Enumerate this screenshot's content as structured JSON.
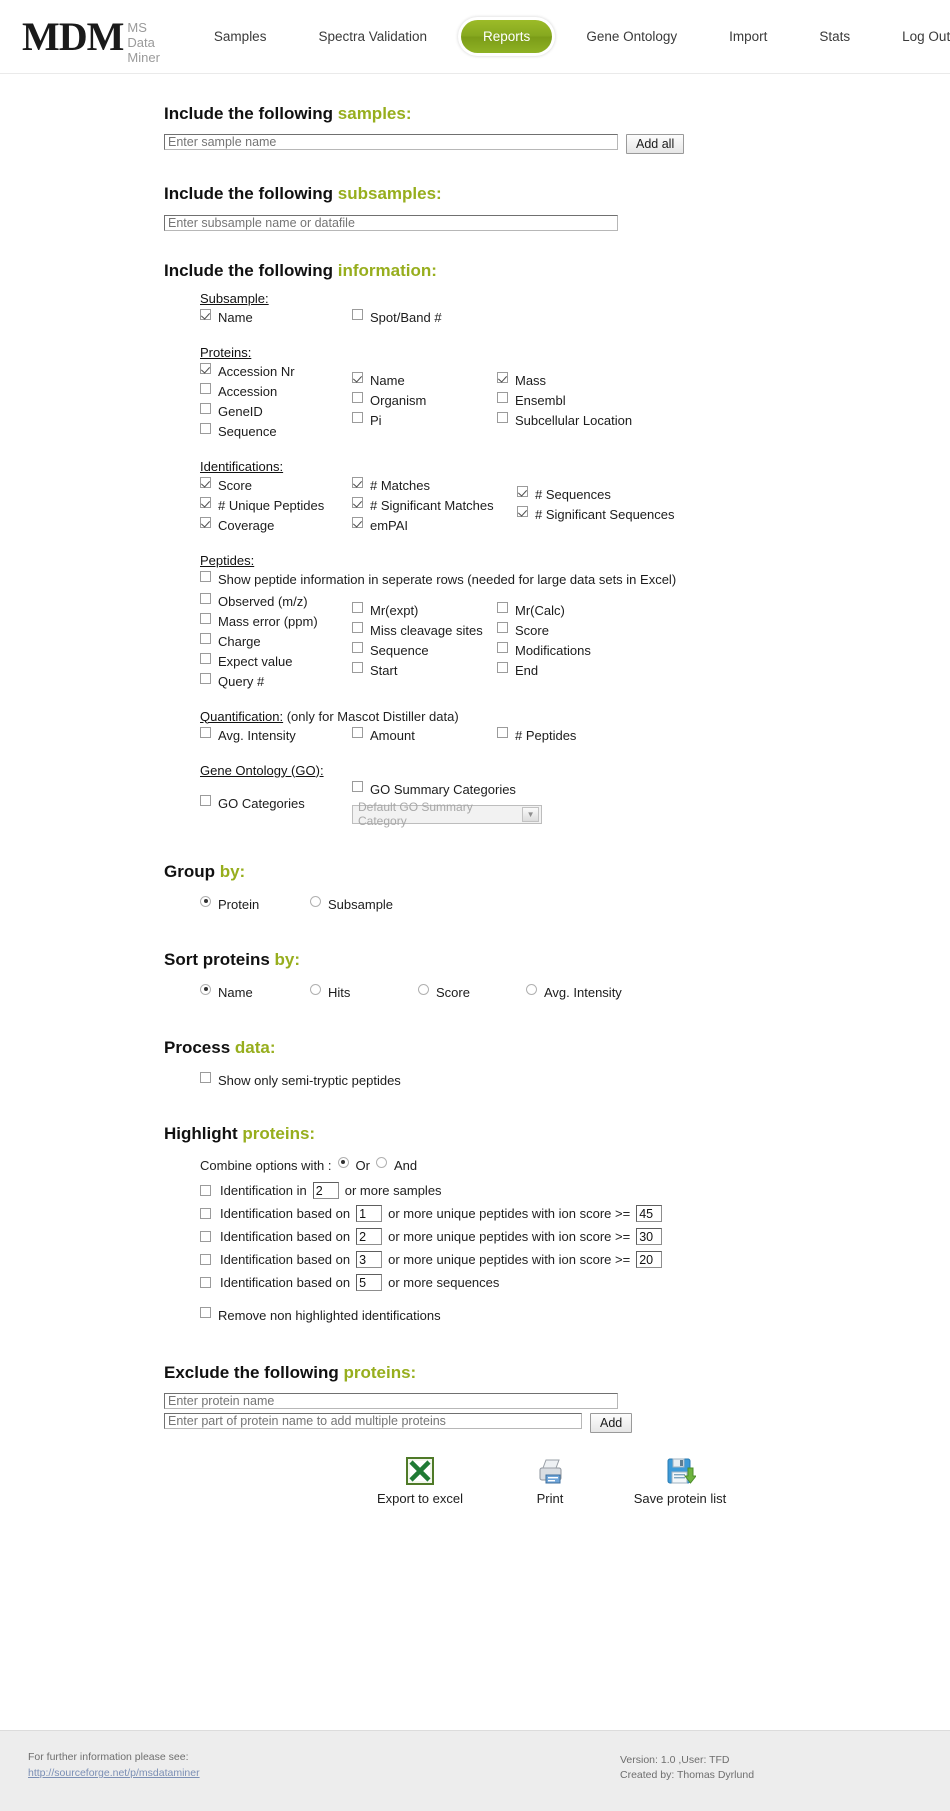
{
  "header": {
    "logo": "MDM",
    "logo_subtitle": "MS Data Miner",
    "nav": [
      {
        "label": "Samples",
        "active": false
      },
      {
        "label": "Spectra Validation",
        "active": false
      },
      {
        "label": "Reports",
        "active": true
      },
      {
        "label": "Gene Ontology",
        "active": false
      },
      {
        "label": "Import",
        "active": false
      },
      {
        "label": "Stats",
        "active": false
      },
      {
        "label": "Log Out",
        "active": false
      }
    ],
    "accent_color": "#8fb224"
  },
  "samples_section": {
    "title_prefix": "Include the following ",
    "title_accent": "samples:",
    "input_placeholder": "Enter sample name",
    "add_all_label": "Add all"
  },
  "subsamples_section": {
    "title_prefix": "Include the following ",
    "title_accent": "subsamples:",
    "input_placeholder": "Enter subsample name or datafile"
  },
  "information_section": {
    "title_prefix": "Include the following ",
    "title_accent": "information:",
    "groups": [
      {
        "heading": "Subsample:",
        "columns": [
          [
            {
              "label": "Name",
              "checked": true
            }
          ],
          [
            {
              "label": "Spot/Band #",
              "checked": false
            }
          ],
          []
        ]
      },
      {
        "heading": "Proteins:",
        "columns": [
          [
            {
              "label": "Accession Nr",
              "checked": true
            },
            {
              "label": "Accession",
              "checked": false
            },
            {
              "label": "GeneID",
              "checked": false
            },
            {
              "label": "Sequence",
              "checked": false
            }
          ],
          [
            {
              "label": "Name",
              "checked": true
            },
            {
              "label": "Organism",
              "checked": false
            },
            {
              "label": "Pi",
              "checked": false
            }
          ],
          [
            {
              "label": "Mass",
              "checked": true
            },
            {
              "label": "Ensembl",
              "checked": false
            },
            {
              "label": "Subcellular Location",
              "checked": false
            }
          ]
        ]
      },
      {
        "heading": "Identifications:",
        "columns": [
          [
            {
              "label": "Score",
              "checked": true
            },
            {
              "label": "# Unique Peptides",
              "checked": true
            },
            {
              "label": "Coverage",
              "checked": true
            }
          ],
          [
            {
              "label": "# Matches",
              "checked": true
            },
            {
              "label": "# Significant Matches",
              "checked": true
            },
            {
              "label": "emPAI",
              "checked": true
            }
          ],
          [
            {
              "label": "# Sequences",
              "checked": true
            },
            {
              "label": "# Significant Sequences",
              "checked": true
            }
          ]
        ]
      }
    ],
    "peptides": {
      "heading": "Peptides:",
      "full_width_option": {
        "label": "Show peptide information in seperate rows (needed for large data sets in Excel)",
        "checked": false
      },
      "columns": [
        [
          {
            "label": "Observed (m/z)",
            "checked": false
          },
          {
            "label": "Mass error (ppm)",
            "checked": false
          },
          {
            "label": "Charge",
            "checked": false
          },
          {
            "label": "Expect value",
            "checked": false
          },
          {
            "label": "Query #",
            "checked": false
          }
        ],
        [
          {
            "label": "Mr(expt)",
            "checked": false
          },
          {
            "label": "Miss cleavage sites",
            "checked": false
          },
          {
            "label": "Sequence",
            "checked": false
          },
          {
            "label": "Start",
            "checked": false
          }
        ],
        [
          {
            "label": "Mr(Calc)",
            "checked": false
          },
          {
            "label": "Score",
            "checked": false
          },
          {
            "label": "Modifications",
            "checked": false
          },
          {
            "label": "End",
            "checked": false
          }
        ]
      ]
    },
    "quantification": {
      "heading": "Quantification:",
      "heading_note": " (only for Mascot Distiller data)",
      "columns": [
        [
          {
            "label": "Avg. Intensity",
            "checked": false
          }
        ],
        [
          {
            "label": "Amount",
            "checked": false
          }
        ],
        [
          {
            "label": "# Peptides",
            "checked": false
          }
        ]
      ]
    },
    "gene_ontology": {
      "heading": "Gene Ontology (GO):",
      "go_categories": {
        "label": "GO Categories",
        "checked": false
      },
      "go_summary_categories": {
        "label": "GO Summary Categories",
        "checked": false
      },
      "select_value": "Default GO Summary Category"
    }
  },
  "group_by": {
    "title_prefix": "Group ",
    "title_accent": "by:",
    "options": [
      {
        "label": "Protein",
        "selected": true
      },
      {
        "label": "Subsample",
        "selected": false
      }
    ]
  },
  "sort_by": {
    "title_prefix": "Sort proteins ",
    "title_accent": "by:",
    "options": [
      {
        "label": "Name",
        "selected": true
      },
      {
        "label": "Hits",
        "selected": false
      },
      {
        "label": "Score",
        "selected": false
      },
      {
        "label": "Avg. Intensity",
        "selected": false
      }
    ]
  },
  "process_data": {
    "title_prefix": "Process ",
    "title_accent": "data:",
    "options": [
      {
        "label": "Show only semi-tryptic peptides",
        "checked": false
      }
    ]
  },
  "highlight_proteins": {
    "title_prefix": "Highlight ",
    "title_accent": "proteins:",
    "combine_label": "Combine options with :",
    "combine_options": [
      {
        "label": "Or",
        "selected": true
      },
      {
        "label": "And",
        "selected": false
      }
    ],
    "rules": [
      {
        "checked": false,
        "text_before": "Identification in",
        "value1": "2",
        "text_middle": "or more samples",
        "value2": null,
        "text_after": null
      },
      {
        "checked": false,
        "text_before": "Identification based on",
        "value1": "1",
        "text_middle": "or more unique peptides with ion score >=",
        "value2": "45",
        "text_after": ""
      },
      {
        "checked": false,
        "text_before": "Identification based on",
        "value1": "2",
        "text_middle": "or more unique peptides with ion score >=",
        "value2": "30",
        "text_after": ""
      },
      {
        "checked": false,
        "text_before": "Identification based on",
        "value1": "3",
        "text_middle": "or more unique peptides with ion score >=",
        "value2": "20",
        "text_after": ""
      },
      {
        "checked": false,
        "text_before": "Identification based on",
        "value1": "5",
        "text_middle": "or more sequences",
        "value2": null,
        "text_after": null
      }
    ],
    "remove_option": {
      "label": "Remove non highlighted identifications",
      "checked": false
    }
  },
  "exclude_proteins": {
    "title_prefix": "Exclude the following ",
    "title_accent": "proteins:",
    "input1_placeholder": "Enter protein name",
    "input2_placeholder": "Enter part of protein name to add multiple proteins",
    "add_label": "Add"
  },
  "actions": [
    {
      "label": "Export to excel",
      "icon": "excel-icon"
    },
    {
      "label": "Print",
      "icon": "printer-icon"
    },
    {
      "label": "Save protein list",
      "icon": "floppy-save-icon"
    }
  ],
  "footer": {
    "info_text": "For further information please see:",
    "link_text": "http://sourceforge.net/p/msdataminer",
    "version_line": "Version: 1.0 ,User: TFD",
    "created_line": "Created by: Thomas Dyrlund"
  }
}
